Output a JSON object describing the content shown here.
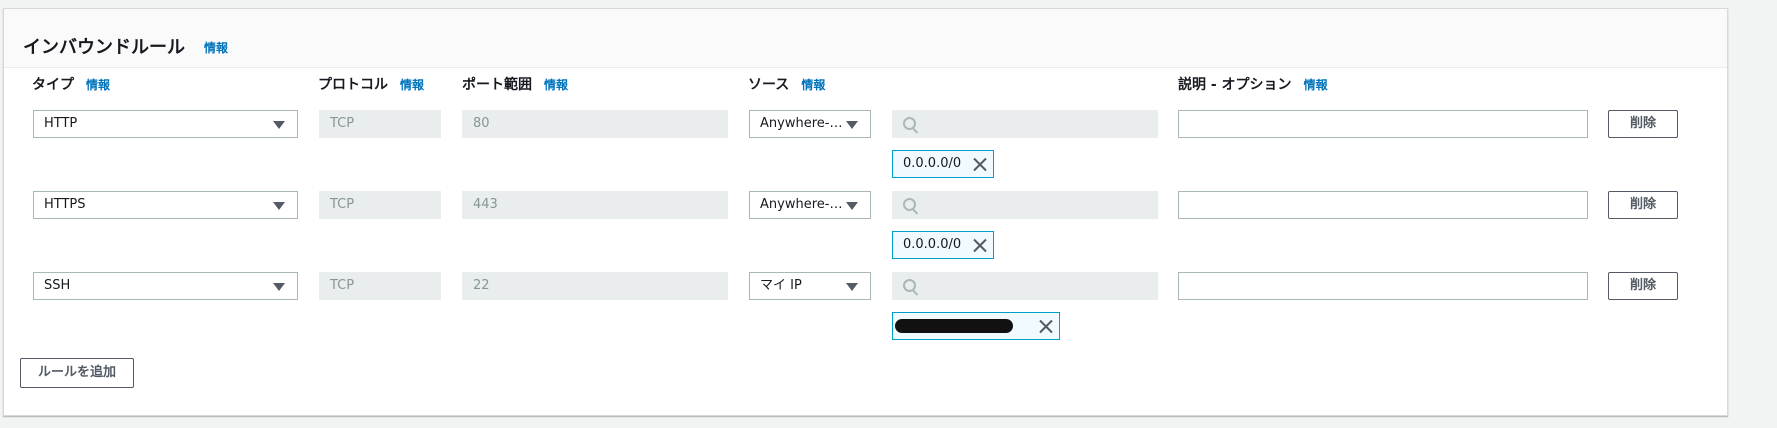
{
  "panel": {
    "title": "インバウンドルール",
    "title_info": "情報"
  },
  "columns": {
    "type": {
      "label": "タイプ",
      "info": "情報"
    },
    "protocol": {
      "label": "プロトコル",
      "info": "情報"
    },
    "port": {
      "label": "ポート範囲",
      "info": "情報"
    },
    "source": {
      "label": "ソース",
      "info": "情報"
    },
    "description": {
      "label": "説明 - オプション",
      "info": "情報"
    }
  },
  "rules": [
    {
      "type": "HTTP",
      "protocol": "TCP",
      "port": "80",
      "source": "Anywhere-…",
      "cidr": "0.0.0.0/0",
      "description": "",
      "delete_label": "削除"
    },
    {
      "type": "HTTPS",
      "protocol": "TCP",
      "port": "443",
      "source": "Anywhere-…",
      "cidr": "0.0.0.0/0",
      "description": "",
      "delete_label": "削除"
    },
    {
      "type": "SSH",
      "protocol": "TCP",
      "port": "22",
      "source": "マイ IP",
      "cidr": "[redacted]",
      "description": "",
      "delete_label": "削除"
    }
  ],
  "add_rule_label": "ルールを追加",
  "colors": {
    "accent": "#0073bb",
    "token_border": "#00a1c9",
    "disabled_bg": "#eaeded"
  }
}
